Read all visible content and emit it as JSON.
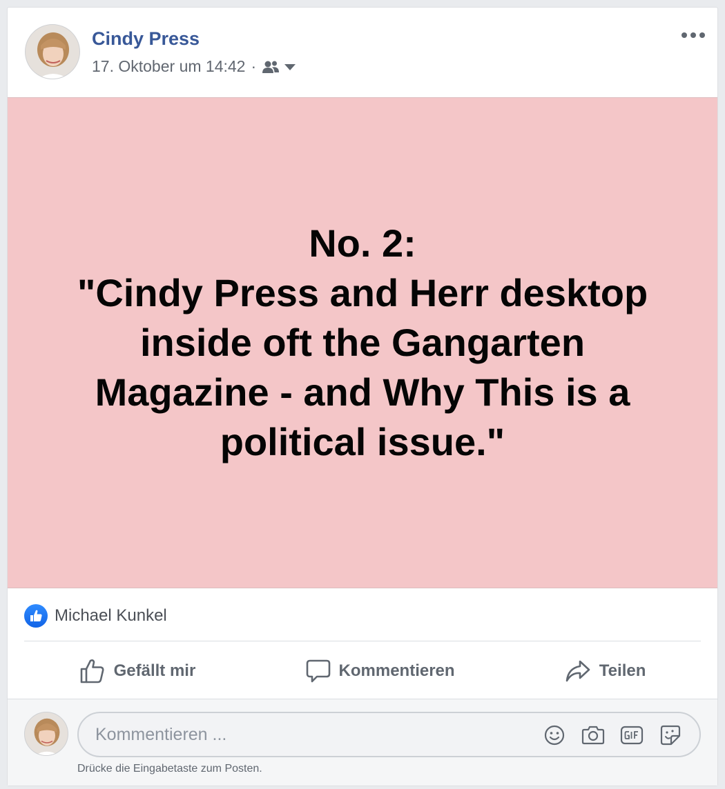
{
  "post": {
    "author": "Cindy Press",
    "timestamp": "17. Oktober um 14:42",
    "separator": "·",
    "audience_icon": "friends-icon",
    "background_color": "#f4c6c8",
    "text": "No. 2:\n\"Cindy Press and Herr desktop inside oft the Gangarten Magazine - and Why This is a political issue.\""
  },
  "reactions": {
    "type_icon": "like-icon",
    "names": "Michael Kunkel"
  },
  "actions": {
    "like_label": "Gefällt mir",
    "comment_label": "Kommentieren",
    "share_label": "Teilen"
  },
  "comment_composer": {
    "placeholder": "Kommentieren ...",
    "hint": "Drücke die Eingabetaste zum Posten.",
    "icons": [
      "emoji-icon",
      "camera-icon",
      "gif-icon",
      "sticker-icon"
    ]
  },
  "colors": {
    "link": "#385898",
    "like_blue": "#1877f2",
    "muted_text": "#606770"
  }
}
